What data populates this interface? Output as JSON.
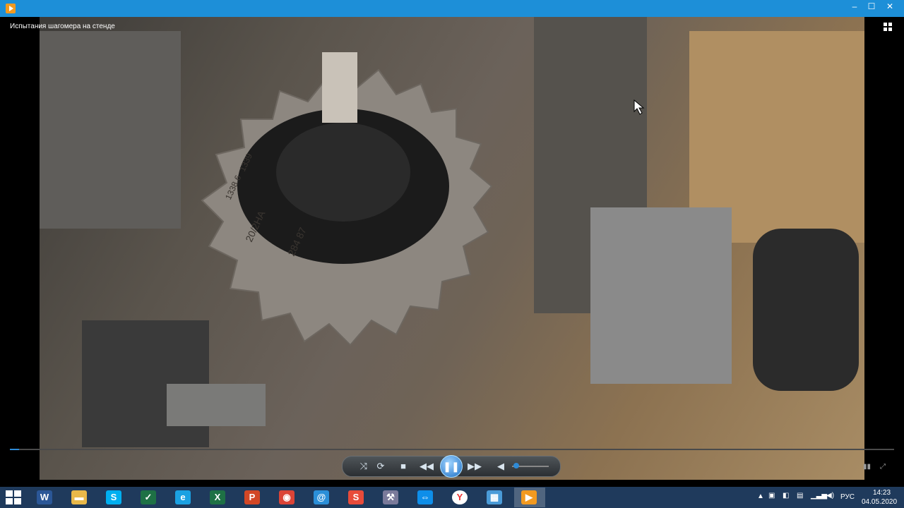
{
  "window": {
    "title": "",
    "controls": {
      "minimize": "–",
      "maximize": "☐",
      "close": "✕"
    }
  },
  "player": {
    "media_title": "Испытания шагомера на стенде",
    "progress_fraction": 0.01,
    "volume_fraction": 0.1,
    "controls": [
      "shuffle",
      "repeat",
      "stop",
      "previous",
      "pause",
      "next",
      "mute"
    ]
  },
  "video_markings": [
    "20/2НА",
    "284 87",
    "1338 6",
    "1339"
  ],
  "taskbar": {
    "apps": [
      "word-icon",
      "file-explorer-icon",
      "skype-icon",
      "excel-green-icon",
      "internet-explorer-icon",
      "excel-icon",
      "powerpoint-icon",
      "chrome-icon",
      "mail-at-icon",
      "s-app-icon",
      "tool-icon",
      "teamviewer-icon",
      "yandex-icon",
      "control-panel-icon",
      "media-player-icon"
    ],
    "active_index": 14
  },
  "tray": {
    "language": "РУС",
    "time": "14:23",
    "date": "04.05.2020"
  },
  "colors": {
    "titlebar": "#1d8fd8",
    "taskbar": "#1f3a5c",
    "accent": "#2e8ad6"
  }
}
